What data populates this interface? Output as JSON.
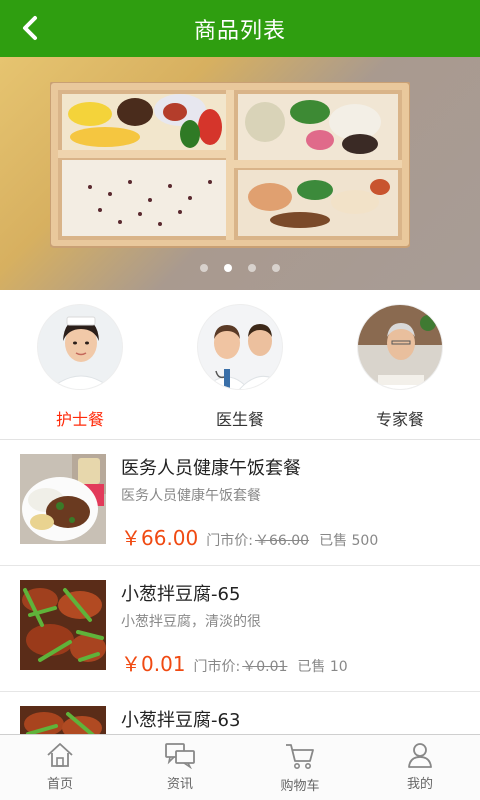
{
  "header": {
    "title": "商品列表",
    "back_icon": "chevron-left-icon",
    "bar_color": "#2f9e10"
  },
  "banner": {
    "slide_count": 4,
    "active_slide": 2
  },
  "categories": [
    {
      "label": "护士餐",
      "active": true
    },
    {
      "label": "医生餐",
      "active": false
    },
    {
      "label": "专家餐",
      "active": false
    }
  ],
  "products": [
    {
      "name": "医务人员健康午饭套餐",
      "desc": "医务人员健康午饭套餐",
      "price": "￥66.00",
      "market_label": "门市价:",
      "market_price": "￥66.00",
      "sold": "已售 500"
    },
    {
      "name": "小葱拌豆腐-65",
      "desc": "小葱拌豆腐，清淡的很",
      "price": "￥0.01",
      "market_label": "门市价:",
      "market_price": "￥0.01",
      "sold": "已售 10"
    },
    {
      "name": "小葱拌豆腐-63",
      "desc": "",
      "price": "",
      "market_label": "",
      "market_price": "",
      "sold": ""
    }
  ],
  "tabbar": [
    {
      "label": "首页",
      "icon": "home-icon"
    },
    {
      "label": "资讯",
      "icon": "chat-icon"
    },
    {
      "label": "购物车",
      "icon": "cart-icon"
    },
    {
      "label": "我的",
      "icon": "user-icon"
    }
  ],
  "colors": {
    "price": "#f04a12",
    "active_category": "#ff2a0a"
  }
}
